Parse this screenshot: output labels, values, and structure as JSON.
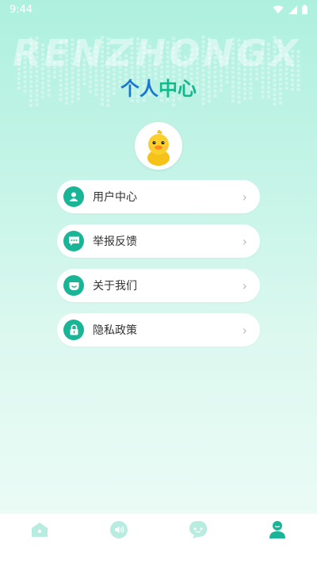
{
  "status_bar": {
    "time": "9:44"
  },
  "banner": {
    "watermark": "RENZHONGX"
  },
  "header": {
    "title_part1": "个人",
    "title_part2": "中心"
  },
  "menu": {
    "items": [
      {
        "label": "用户中心",
        "icon": "user-icon"
      },
      {
        "label": "举报反馈",
        "icon": "chat-dots-icon"
      },
      {
        "label": "关于我们",
        "icon": "smile-icon"
      },
      {
        "label": "隐私政策",
        "icon": "lock-icon"
      }
    ],
    "chevron": "›"
  },
  "bottom_nav": {
    "items": [
      {
        "icon": "home-icon",
        "active": false
      },
      {
        "icon": "speaker-icon",
        "active": false
      },
      {
        "icon": "chat-icon",
        "active": false
      },
      {
        "icon": "profile-icon",
        "active": true
      }
    ],
    "active_color": "#19b596",
    "inactive_color": "#b8ece0"
  },
  "colors": {
    "accent": "#19b596",
    "title_blue": "#1976d2",
    "title_green": "#14b88c"
  }
}
